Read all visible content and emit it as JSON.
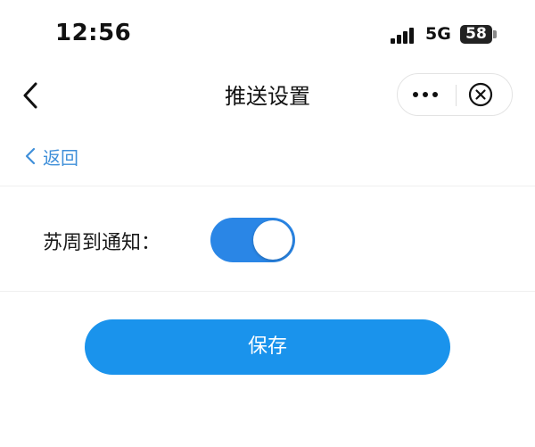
{
  "status_bar": {
    "time": "12:56",
    "network": "5G",
    "battery": "58"
  },
  "nav": {
    "title": "推送设置",
    "back_icon": "chevron-left-icon",
    "more_icon": "more-dots-icon",
    "close_icon": "close-circle-icon"
  },
  "back_link": {
    "label": "返回"
  },
  "settings": {
    "items": [
      {
        "label": "苏周到通知：",
        "enabled": true
      }
    ]
  },
  "actions": {
    "save_label": "保存"
  },
  "colors": {
    "accent": "#2a86e6",
    "button": "#1a93ec",
    "link": "#3f8fd9"
  }
}
